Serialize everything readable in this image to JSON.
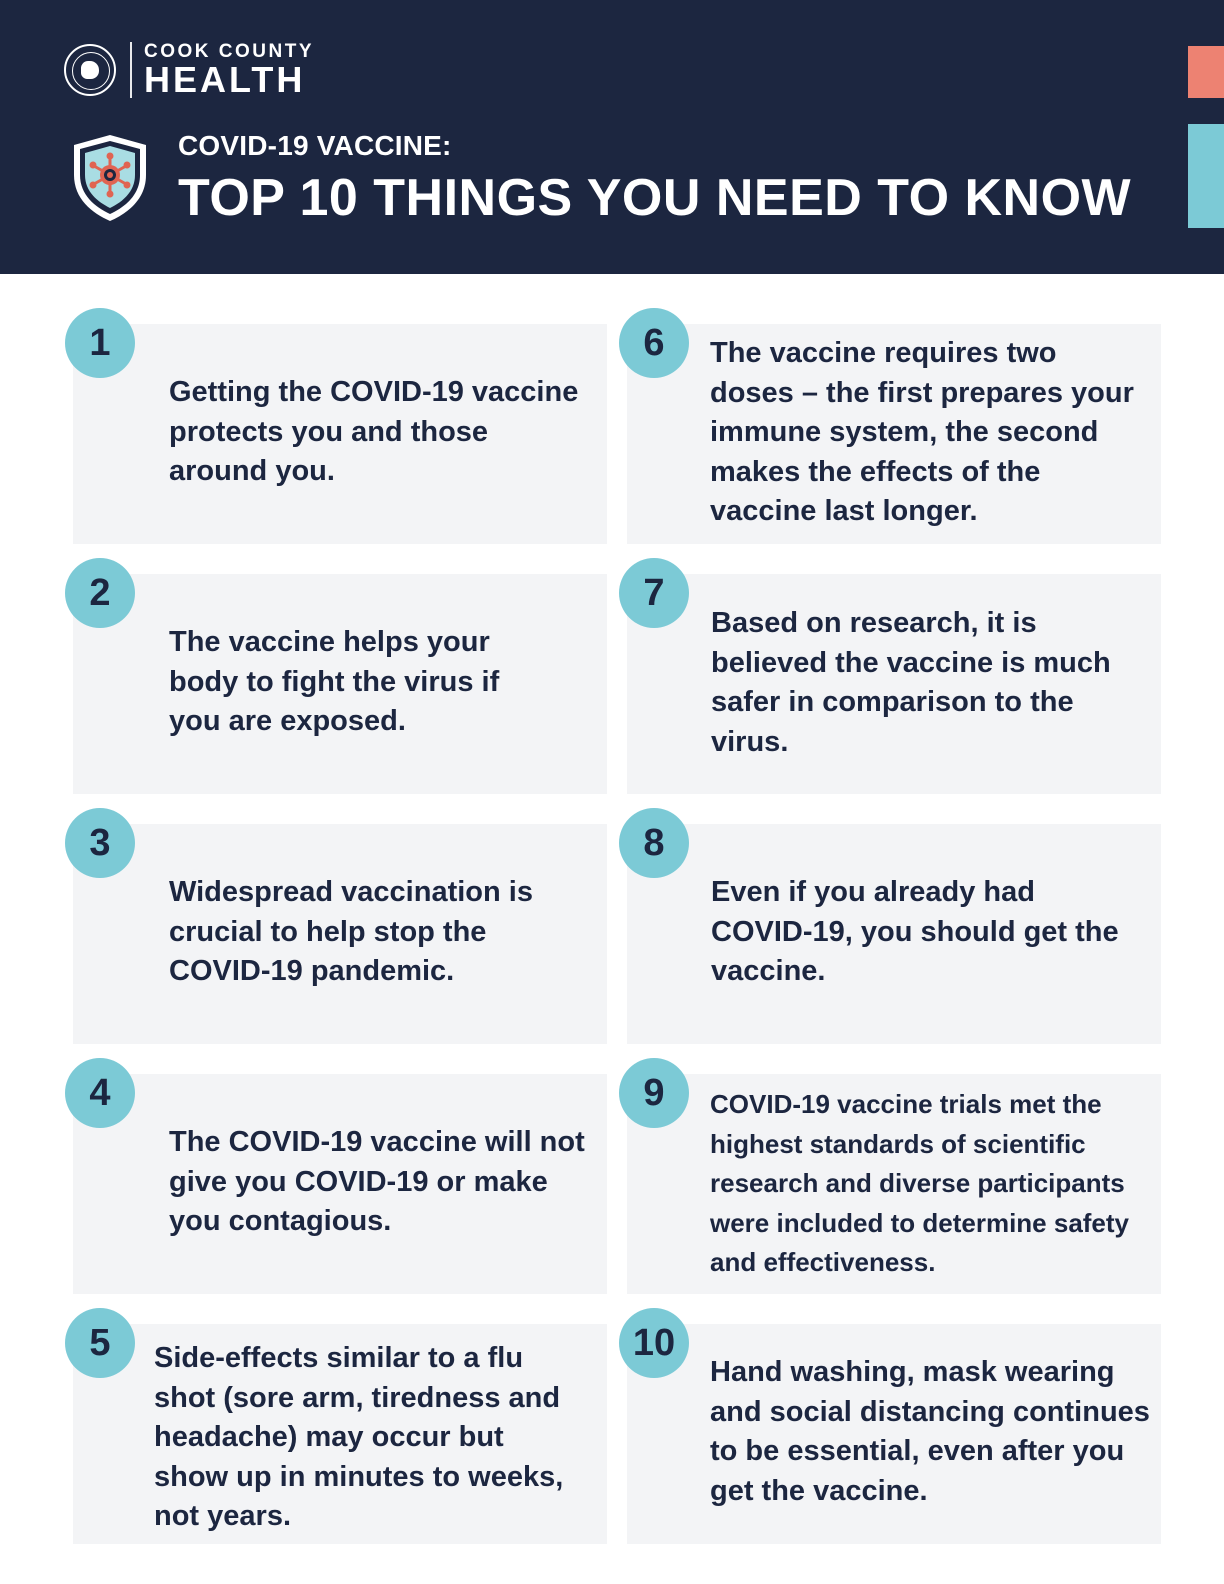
{
  "header": {
    "logo_line1": "COOK COUNTY",
    "logo_line2": "HEALTH",
    "subtitle": "COVID-19 VACCINE:",
    "title": "TOP 10 THINGS YOU NEED TO KNOW",
    "colors": {
      "navy": "#1c2640",
      "teal": "#7ccad6",
      "coral": "#ed8272"
    },
    "icons": [
      "county-seal-icon",
      "virus-shield-icon"
    ]
  },
  "items": [
    {
      "number": "1",
      "text": "Getting the COVID-19 vaccine protects you and those around you."
    },
    {
      "number": "2",
      "text": "The vaccine helps your body to fight the virus if you are exposed."
    },
    {
      "number": "3",
      "text": "Widespread vaccination is crucial to help stop the COVID-19 pandemic."
    },
    {
      "number": "4",
      "text": "The COVID-19 vaccine will not give you COVID-19 or make you contagious."
    },
    {
      "number": "5",
      "text": "Side-effects similar to a flu shot (sore arm, tiredness and headache) may occur but show up in minutes to weeks, not years."
    },
    {
      "number": "6",
      "text": "The vaccine requires two doses – the first prepares your immune system, the second makes the effects of the vaccine last longer."
    },
    {
      "number": "7",
      "text": "Based on research, it is believed the vaccine is much safer in comparison to the virus."
    },
    {
      "number": "8",
      "text": "Even if you already had COVID-19, you should get the vaccine."
    },
    {
      "number": "9",
      "text": "COVID-19 vaccine trials met the highest standards of scientific research and diverse participants were included to determine safety and effectiveness."
    },
    {
      "number": "10",
      "text": "Hand washing, mask wearing and social distancing continues to be essential, even after you get the vaccine."
    }
  ]
}
